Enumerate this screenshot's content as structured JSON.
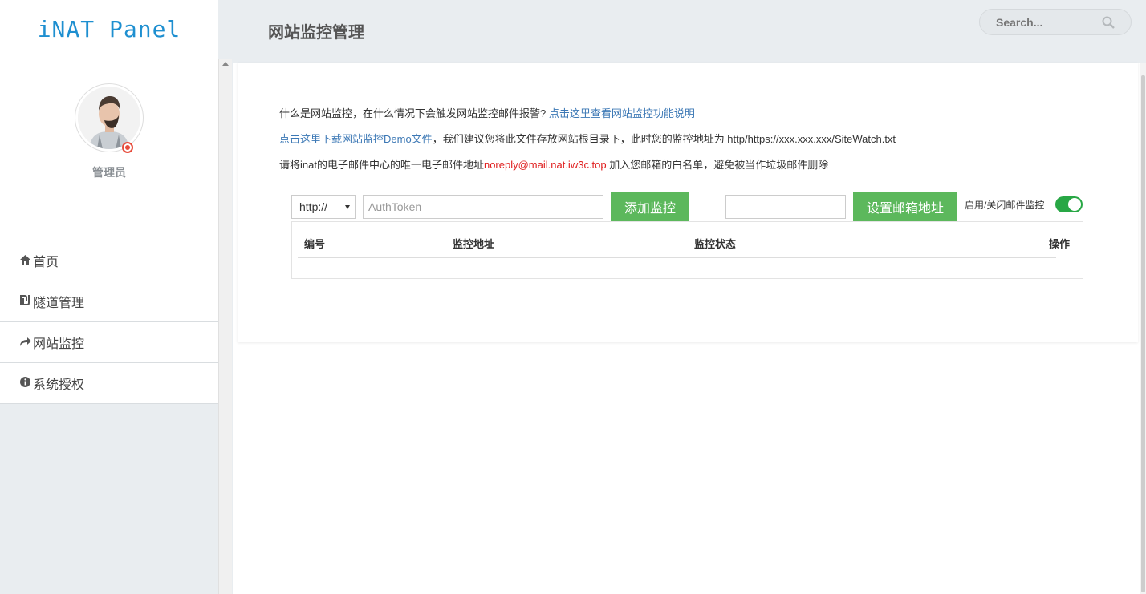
{
  "brand": "iNAT Panel",
  "user": {
    "role": "管理员"
  },
  "nav": [
    {
      "icon": "home-icon",
      "glyph": "⌂",
      "label": "首页"
    },
    {
      "icon": "tunnel-icon",
      "glyph": "₪",
      "label": "隧道管理"
    },
    {
      "icon": "share-icon",
      "glyph": "↪",
      "label": "网站监控"
    },
    {
      "icon": "info-icon",
      "glyph": "ℹ",
      "label": "系统授权"
    }
  ],
  "header": {
    "title": "网站监控管理",
    "search_placeholder": "Search..."
  },
  "info": {
    "line1_text": "什么是网站监控，在什么情况下会触发网站监控邮件报警? ",
    "line1_link": "点击这里查看网站监控功能说明",
    "line2_link": "点击这里下载网站监控Demo文件",
    "line2_text": "，我们建议您将此文件存放网站根目录下，此时您的监控地址为 http/https://xxx.xxx.xxx/SiteWatch.txt",
    "line3_pre": "请将inat的电子邮件中心的唯一电子邮件地址",
    "line3_email": "noreply@mail.nat.iw3c.top",
    "line3_post": " 加入您邮箱的白名单，避免被当作垃圾邮件删除"
  },
  "controls": {
    "protocol_selected": "http://",
    "token_placeholder": "AuthToken",
    "add_button": "添加监控",
    "email_value": "",
    "set_email_button": "设置邮箱地址",
    "toggle_label": "启用/关闭邮件监控",
    "toggle_on": true
  },
  "table": {
    "headers": [
      "编号",
      "监控地址",
      "监控状态",
      "操作"
    ],
    "rows": []
  },
  "colors": {
    "brand": "#1e8fd0",
    "accent_green": "#5cb85c",
    "link": "#3c78b5",
    "email_red": "#e02020",
    "toggle_green": "#28a745"
  }
}
